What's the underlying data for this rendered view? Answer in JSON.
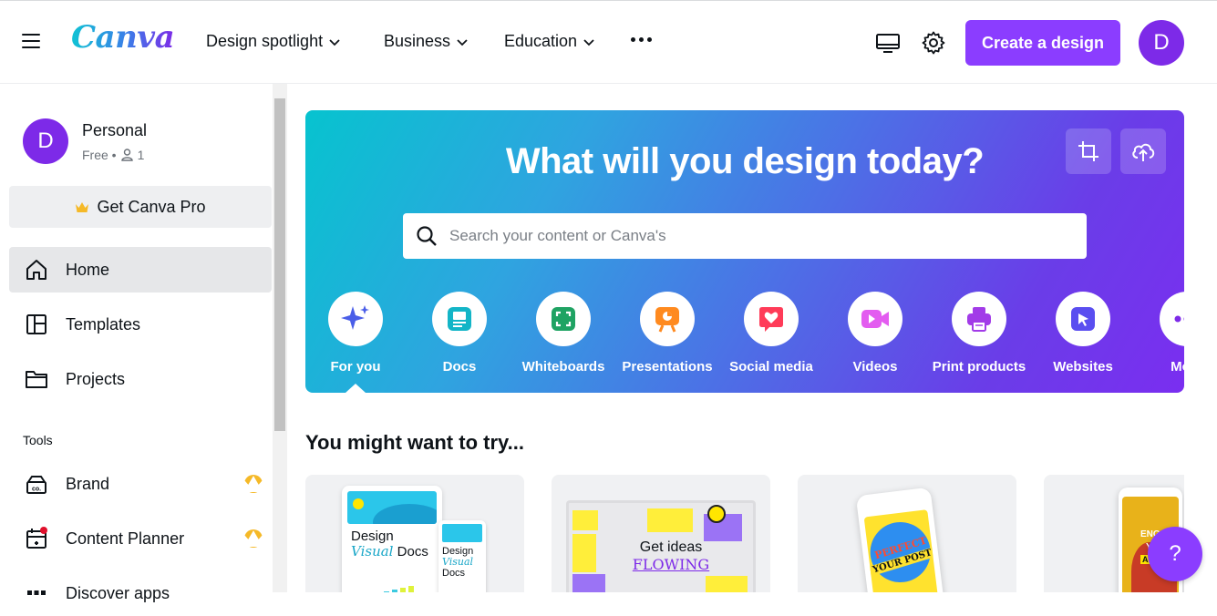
{
  "header": {
    "logo_text": "Canva",
    "nav": [
      {
        "label": "Design spotlight"
      },
      {
        "label": "Business"
      },
      {
        "label": "Education"
      }
    ],
    "create_label": "Create a design",
    "avatar_initial": "D"
  },
  "sidebar": {
    "account": {
      "initial": "D",
      "name": "Personal",
      "plan": "Free •",
      "members": "1"
    },
    "pro_label": "Get Canva Pro",
    "items": [
      {
        "label": "Home",
        "icon": "home-icon",
        "active": true
      },
      {
        "label": "Templates",
        "icon": "templates-icon"
      },
      {
        "label": "Projects",
        "icon": "folder-icon"
      }
    ],
    "tools_heading": "Tools",
    "tools": [
      {
        "label": "Brand",
        "icon": "brand-icon",
        "pro": true
      },
      {
        "label": "Content Planner",
        "icon": "calendar-icon",
        "pro": true
      },
      {
        "label": "Discover apps",
        "icon": "apps-icon"
      }
    ]
  },
  "hero": {
    "title": "What will you design today?",
    "search_placeholder": "Search your content or Canva's",
    "categories": [
      {
        "label": "For you",
        "icon": "sparkle-icon",
        "color": "#4a5ee8"
      },
      {
        "label": "Docs",
        "icon": "docs-icon",
        "color": "#13b5c7"
      },
      {
        "label": "Whiteboards",
        "icon": "whiteboard-icon",
        "color": "#1fa363"
      },
      {
        "label": "Presentations",
        "icon": "presentation-icon",
        "color": "#ff8a1f"
      },
      {
        "label": "Social media",
        "icon": "heart-icon",
        "color": "#ff3b58"
      },
      {
        "label": "Videos",
        "icon": "video-icon",
        "color": "#e35cf0"
      },
      {
        "label": "Print products",
        "icon": "printer-icon",
        "color": "#a23be8"
      },
      {
        "label": "Websites",
        "icon": "cursor-icon",
        "color": "#5a4ef0"
      },
      {
        "label": "More",
        "icon": "more-icon",
        "color": "#7d2ae8"
      }
    ]
  },
  "section_title": "You might want to try...",
  "cards": [
    {
      "name": "docs-card",
      "title_a": "Design",
      "title_b": "Visual",
      "title_c": "Docs",
      "mini_a": "Design",
      "mini_b": "Visual",
      "mini_c": "Docs"
    },
    {
      "name": "whiteboard-card",
      "text_a": "Get ideas",
      "text_b": "FLOWING"
    },
    {
      "name": "social-card",
      "text_a": "PERFECT",
      "text_b": "YOUR POST"
    },
    {
      "name": "video-card",
      "text_a": "ENGA",
      "text_b": "YO",
      "text_c": "AUDI"
    }
  ],
  "help_label": "?",
  "colors": {
    "brand_purple": "#8b3dff",
    "avatar_purple": "#7d2ae8",
    "pro_gold": "#f5b928"
  }
}
